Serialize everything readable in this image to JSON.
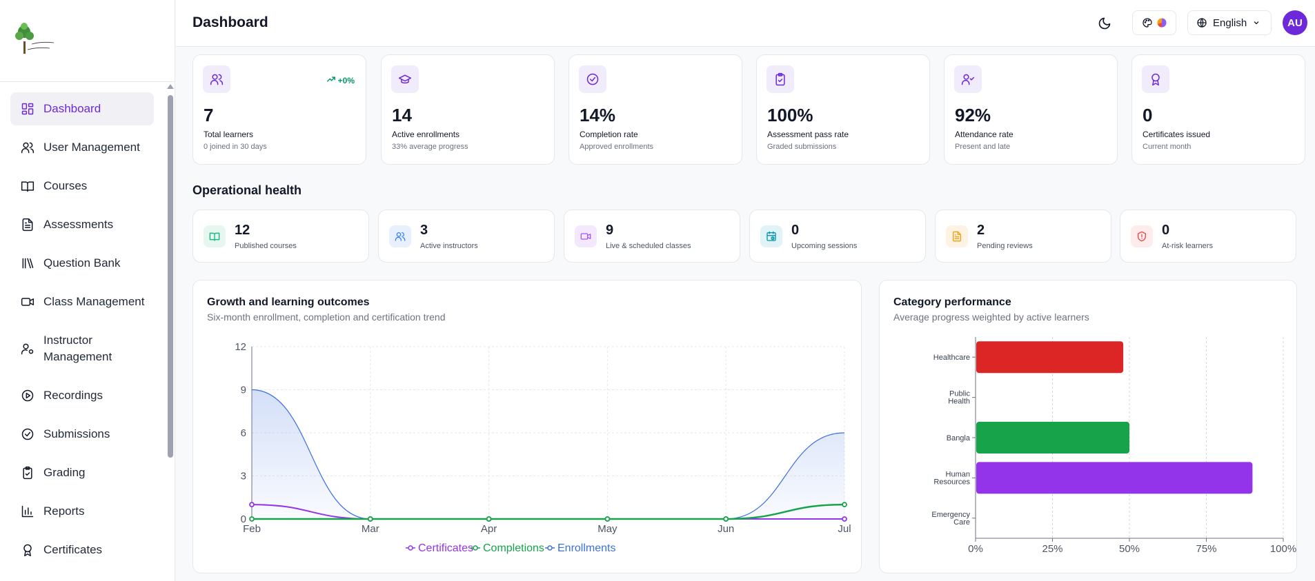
{
  "header": {
    "title": "Dashboard",
    "language": "English",
    "avatar_initials": "AU"
  },
  "sidebar": {
    "items": [
      {
        "label": "Dashboard",
        "icon": "dashboard-icon",
        "active": true
      },
      {
        "label": "User Management",
        "icon": "users-icon"
      },
      {
        "label": "Courses",
        "icon": "book-icon"
      },
      {
        "label": "Assessments",
        "icon": "document-icon"
      },
      {
        "label": "Question Bank",
        "icon": "library-icon"
      },
      {
        "label": "Class Management",
        "icon": "video-icon"
      },
      {
        "label": "Instructor Management",
        "icon": "user-gear-icon"
      },
      {
        "label": "Recordings",
        "icon": "play-circle-icon"
      },
      {
        "label": "Submissions",
        "icon": "check-circle-icon"
      },
      {
        "label": "Grading",
        "icon": "clipboard-check-icon"
      },
      {
        "label": "Reports",
        "icon": "bar-chart-icon"
      },
      {
        "label": "Certificates",
        "icon": "award-icon"
      }
    ]
  },
  "stats": [
    {
      "value": "7",
      "label": "Total learners",
      "sub": "0 joined in 30 days",
      "trend": "+0%",
      "icon": "users-icon"
    },
    {
      "value": "14",
      "label": "Active enrollments",
      "sub": "33% average progress",
      "icon": "graduation-cap-icon"
    },
    {
      "value": "14%",
      "label": "Completion rate",
      "sub": "Approved enrollments",
      "icon": "check-circle-icon"
    },
    {
      "value": "100%",
      "label": "Assessment pass rate",
      "sub": "Graded submissions",
      "icon": "clipboard-check-icon"
    },
    {
      "value": "92%",
      "label": "Attendance rate",
      "sub": "Present and late",
      "icon": "user-check-icon"
    },
    {
      "value": "0",
      "label": "Certificates issued",
      "sub": "Current month",
      "icon": "award-icon"
    }
  ],
  "operational": {
    "title": "Operational health",
    "items": [
      {
        "value": "12",
        "label": "Published courses",
        "icon": "book-open-icon",
        "color": "#10b981",
        "bg": "#e6f7ef"
      },
      {
        "value": "3",
        "label": "Active instructors",
        "icon": "users-icon",
        "color": "#3b82f6",
        "bg": "#e8f0fe"
      },
      {
        "value": "9",
        "label": "Live & scheduled classes",
        "icon": "video-icon",
        "color": "#a855f7",
        "bg": "#f3e8fd"
      },
      {
        "value": "0",
        "label": "Upcoming sessions",
        "icon": "calendar-clock-icon",
        "color": "#0891b2",
        "bg": "#e0f4f8"
      },
      {
        "value": "2",
        "label": "Pending reviews",
        "icon": "file-text-icon",
        "color": "#f59e0b",
        "bg": "#fdf3e3"
      },
      {
        "value": "0",
        "label": "At-risk learners",
        "icon": "shield-alert-icon",
        "color": "#ef4444",
        "bg": "#fdecec"
      }
    ]
  },
  "growth": {
    "title": "Growth and learning outcomes",
    "subtitle": "Six-month enrollment, completion and certification trend"
  },
  "category": {
    "title": "Category performance",
    "subtitle": "Average progress weighted by active learners"
  },
  "chart_data": [
    {
      "type": "area",
      "title": "Growth and learning outcomes",
      "categories": [
        "Feb",
        "Mar",
        "Apr",
        "May",
        "Jun",
        "Jul"
      ],
      "ylim": [
        0,
        12
      ],
      "yticks": [
        "0",
        "3",
        "6",
        "9",
        "12"
      ],
      "series": [
        {
          "name": "Certificates",
          "values": [
            1,
            0,
            0,
            0,
            0,
            0
          ],
          "color": "#9333ea"
        },
        {
          "name": "Completions",
          "values": [
            0,
            0,
            0,
            0,
            0,
            1
          ],
          "color": "#16a34a"
        },
        {
          "name": "Enrollments",
          "values": [
            9,
            0,
            0,
            0,
            0,
            6
          ],
          "color": "#3b6fe0"
        }
      ],
      "legend": "bottom",
      "grid": true
    },
    {
      "type": "bar",
      "orientation": "horizontal",
      "title": "Category performance",
      "categories": [
        "Healthcare",
        "Public Health",
        "Bangla",
        "Human Resources",
        "Emergency Care"
      ],
      "values": [
        48,
        0,
        50,
        90,
        0
      ],
      "colors": [
        "#dc2626",
        "#9ca3af",
        "#16a34a",
        "#9333ea",
        "#9ca3af"
      ],
      "xlim": [
        0,
        100
      ],
      "xticks": [
        "0%",
        "25%",
        "50%",
        "75%",
        "100%"
      ],
      "grid": true
    }
  ]
}
